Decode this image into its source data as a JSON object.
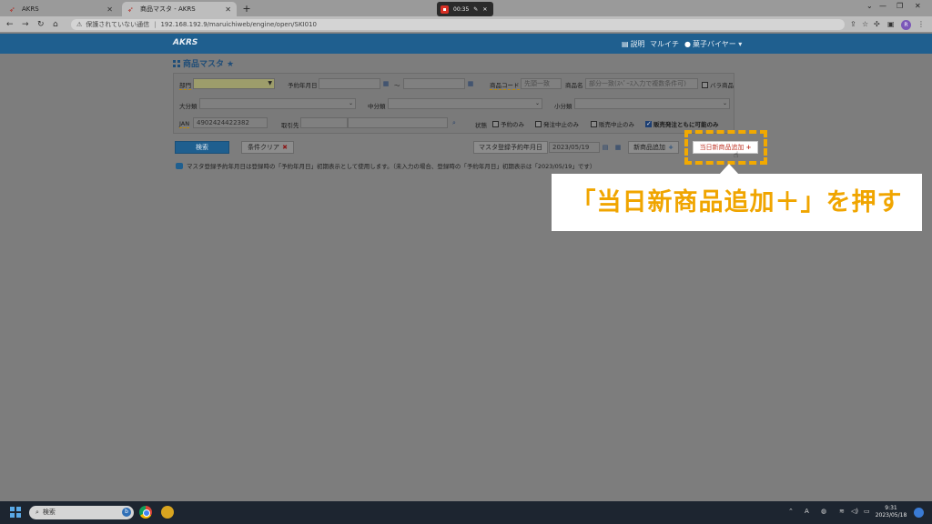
{
  "browser": {
    "tabs": [
      {
        "title": "AKRS",
        "active": false
      },
      {
        "title": "商品マスタ - AKRS",
        "active": true
      }
    ],
    "recording_time": "00:35",
    "address": {
      "warning": "保護されていない通信",
      "url": "192.168.192.9/maruichiweb/engine/open/SKI010"
    },
    "profile_initial": "R"
  },
  "app": {
    "logo": "AKRS",
    "header": {
      "help": "説明",
      "company": "マルイチ",
      "user": "菓子バイヤー"
    }
  },
  "page": {
    "title": "商品マスタ"
  },
  "filters": {
    "department_label": "部門",
    "reservation_date_label": "予約年月日",
    "range_sep": "～",
    "product_code_label": "商品コード",
    "product_code_placeholder": "先頭一致",
    "product_name_label": "商品名",
    "product_name_placeholder": "部分一致(ｽﾍﾟｰｽ入力で複数条件可)",
    "loose_item_label": "バラ商品",
    "major_category_label": "大分類",
    "middle_category_label": "中分類",
    "minor_category_label": "小分類",
    "jan_label": "JAN",
    "jan_value": "4902424422382",
    "supplier_label": "取引先",
    "status_label": "状態",
    "status_options": [
      {
        "label": "予約のみ",
        "checked": false
      },
      {
        "label": "発注中止のみ",
        "checked": false
      },
      {
        "label": "販売中止のみ",
        "checked": false
      },
      {
        "label": "販売発注ともに可能のみ",
        "checked": true
      }
    ]
  },
  "actions": {
    "search": "検索",
    "clear": "条件クリア",
    "master_date_label": "マスタ登録予約年月日",
    "master_date_value": "2023/05/19",
    "new_product": "新商品追加",
    "today_new_product": "当日新商品追加"
  },
  "notice": "マスタ登録予約年月日は登録時の「予約年月日」初期表示として使用します。（未入力の場合、登録時の「予約年月日」初期表示は「2023/05/19」です）",
  "callout": "「当日新商品追加＋」を押す",
  "taskbar": {
    "search_placeholder": "検索",
    "ime": "A",
    "time": "9:31",
    "date": "2023/05/18"
  },
  "colors": {
    "header_blue": "#1f5f8f",
    "highlight": "#f2a900",
    "callout_text": "#f0a500",
    "accent_red": "#c0392b"
  }
}
